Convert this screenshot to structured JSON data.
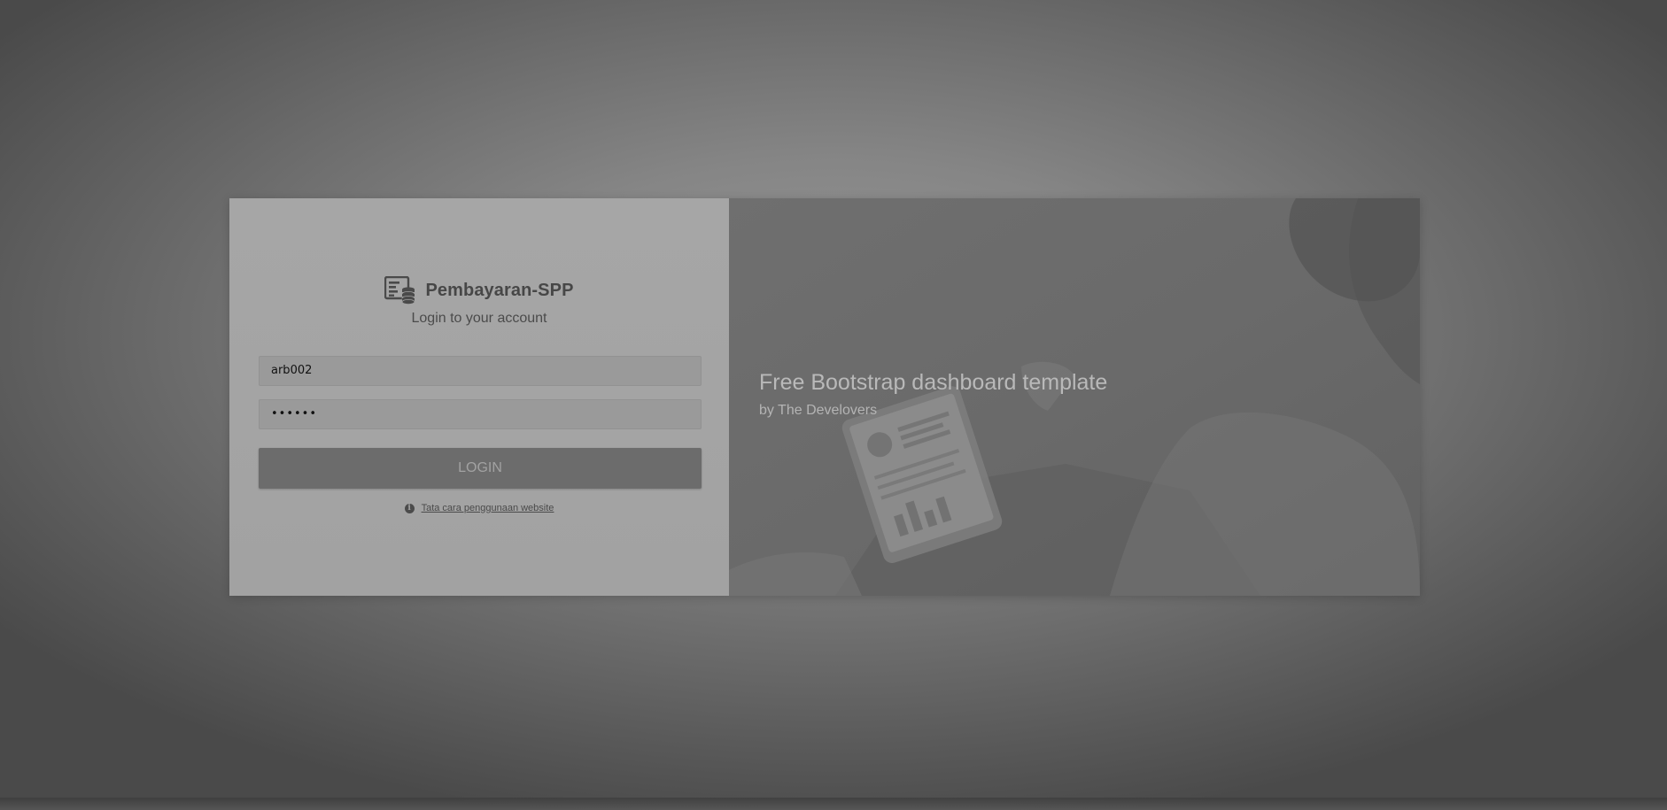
{
  "brand": {
    "name": "Pembayaran-SPP",
    "icon": "money-ledger-icon"
  },
  "login": {
    "subtitle": "Login to your account",
    "username_value": "arb002",
    "password_value": "••••••",
    "button_label": "LOGIN",
    "help_icon": "info-icon",
    "help_link": "Tata cara penggunaan website"
  },
  "hero": {
    "title": "Free Bootstrap dashboard template",
    "byline": "by The Develovers"
  }
}
